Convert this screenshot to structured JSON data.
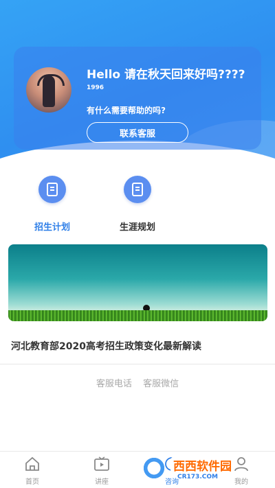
{
  "profile": {
    "greeting": "Hello 请在秋天回来好吗????",
    "user_id": "1996",
    "help_text": "有什么需要帮助的吗?",
    "contact_button": "联系客服"
  },
  "quick_actions": [
    {
      "label": "招生计划",
      "active": true,
      "icon": "book-icon"
    },
    {
      "label": "生涯规划",
      "active": false,
      "icon": "book-icon"
    }
  ],
  "banner": {
    "icon": "grass-field-image"
  },
  "news": {
    "title": "河北教育部2020高考招生政策变化最新解读"
  },
  "service": {
    "phone": "客服电话",
    "wechat": "客服微信"
  },
  "tabs": [
    {
      "label": "首页",
      "icon": "home-icon"
    },
    {
      "label": "讲座",
      "icon": "video-icon"
    },
    {
      "label": "咨询",
      "icon": "chat-icon"
    },
    {
      "label": "我的",
      "icon": "user-icon"
    }
  ],
  "watermark": {
    "main": "西西软件园",
    "sub": "CR173.COM"
  },
  "colors": {
    "accent": "#2f7fe8",
    "hero": "#3598f2",
    "icon_bg": "#5b8ef0"
  }
}
